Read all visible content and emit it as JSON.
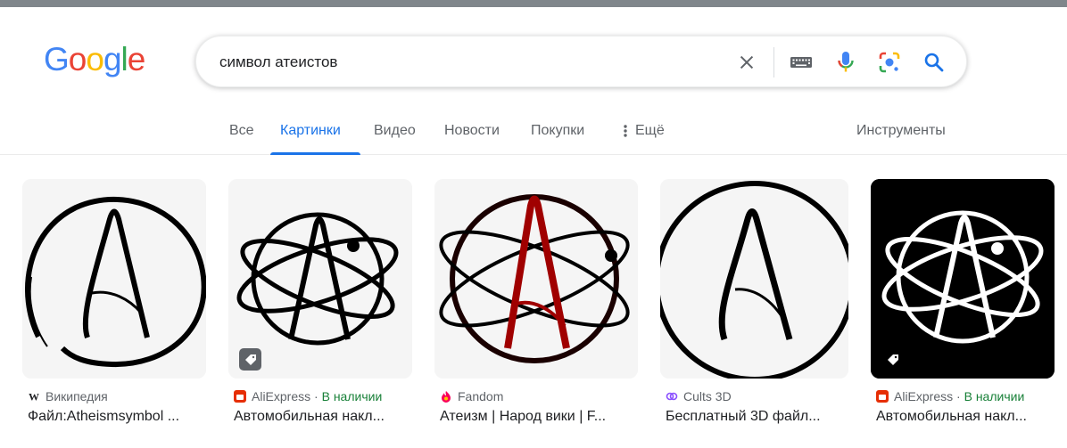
{
  "header": {
    "logo_letters": [
      "G",
      "o",
      "o",
      "g",
      "l",
      "e"
    ],
    "logo_colors": [
      "#4285F4",
      "#EA4335",
      "#FBBC05",
      "#4285F4",
      "#34A853",
      "#EA4335"
    ]
  },
  "search": {
    "query": "символ атеистов",
    "icons": [
      "clear-icon",
      "keyboard-icon",
      "microphone-icon",
      "lens-icon",
      "search-icon"
    ]
  },
  "tabs": [
    {
      "label": "Все",
      "active": false
    },
    {
      "label": "Картинки",
      "active": true
    },
    {
      "label": "Видео",
      "active": false
    },
    {
      "label": "Новости",
      "active": false
    },
    {
      "label": "Покупки",
      "active": false
    },
    {
      "label": "Ещё",
      "active": false
    }
  ],
  "tools_label": "Инструменты",
  "accent_color": "#1a73e8",
  "results": [
    {
      "source": "Википедия",
      "stock": "",
      "title": "Файл:Atheismsymbol ...",
      "favicon": "wikipedia-icon"
    },
    {
      "source": "AliExpress",
      "stock": "В наличии",
      "title": "Автомобильная накл...",
      "favicon": "aliexpress-icon"
    },
    {
      "source": "Fandom",
      "stock": "",
      "title": "Атеизм | Народ вики | F...",
      "favicon": "fandom-icon"
    },
    {
      "source": "Cults 3D",
      "stock": "",
      "title": "Бесплатный 3D файл...",
      "favicon": "cults3d-icon"
    },
    {
      "source": "AliExpress",
      "stock": "В наличии",
      "title": "Автомобильная накл...",
      "favicon": "aliexpress-icon"
    }
  ],
  "separator": "·"
}
